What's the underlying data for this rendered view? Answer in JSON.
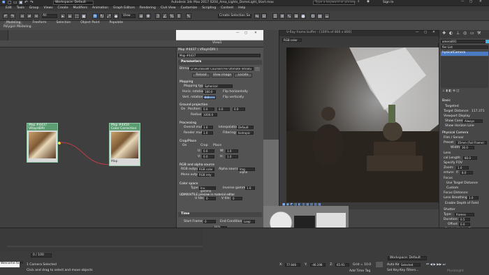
{
  "titlebar": {
    "workspace": "Workspace: Default",
    "title": "Autodesk 3ds Max 2017    0204_Area_Lights_DomeLight_Start.max",
    "search_placeholder": "Type a keyword or phrase",
    "sign_in": "Sign In"
  },
  "menubar": [
    "Edit",
    "Tools",
    "Group",
    "Views",
    "Create",
    "Modifiers",
    "Animation",
    "Graph Editors",
    "Rendering",
    "Civil View",
    "Customize",
    "Scripting",
    "Content",
    "Help"
  ],
  "toolbar": {
    "view_select": "View",
    "selection_set": "Create Selection Se"
  },
  "ribbon": {
    "tabs": [
      "Modeling",
      "Freeform",
      "Selection",
      "Object Paint",
      "Populate"
    ],
    "sub": "Polygon Modeling"
  },
  "sme": {
    "view_label": "View1",
    "node1": {
      "title": "Map #4437",
      "subtitle": "VRayHDRI"
    },
    "node2": {
      "title": "Map #4450",
      "subtitle": "Color Correction",
      "port": "Map"
    }
  },
  "panel": {
    "header": "Map #4437  ( VRayHDRI )",
    "name_field": "Map #4437",
    "rollout": "Parameters",
    "bitmap_label": "Bitmap",
    "bitmap_path": "D:\\Pluralsight Courses\\The Ultimate Introdu",
    "buttons": [
      "Reload",
      "View image",
      "Locate"
    ],
    "mapping_label": "Mapping",
    "mapping_type_label": "Mapping type:",
    "mapping_type": "Spherical",
    "horiz_rot_label": "Horiz. rotation:",
    "horiz_rot": "180.0",
    "flip_h": "Flip horizontally",
    "vert_rot_label": "Vert. rotation:",
    "vert_rot": "0.0",
    "flip_v": "Flip vertically",
    "ground_label": "Ground projection",
    "ground_on": "On",
    "position_label": "Position:",
    "position": [
      "0.0",
      "0.0",
      "0.0"
    ],
    "radius_label": "Radius:",
    "radius": "1000.0",
    "processing_label": "Processing",
    "overall_mult_label": "Overall mult:",
    "overall_mult": "1.0",
    "render_mult_label": "Render mult:",
    "render_mult": "1.0",
    "interp_label": "Interpolation:",
    "interp": "Default",
    "filtering_label": "Filtering:",
    "filtering": "Isotropic",
    "crop_label": "Crop/Place",
    "crop_on": "On",
    "crop": "Crop",
    "place": "Place",
    "u_label": "U:",
    "u": "0.0",
    "w_label": "W:",
    "w": "1.0",
    "v_label": "V:",
    "v": "0.0",
    "h_label": "H:",
    "h": "1.0",
    "rgb_label": "RGB and alpha source",
    "rgb_output_label": "RGB output:",
    "rgb_output": "RGB color",
    "alpha_source_label": "Alpha source:",
    "alpha_source": "Img. alpha",
    "mono_label": "Mono output:",
    "mono": "RGB inty",
    "colorspace_label": "Color space",
    "type_label": "Type:",
    "type": "Inv. gamma",
    "inv_gamma_label": "Inverse gamma:",
    "inv_gamma": "1.0",
    "udim_label": "UDIM/UVTILE preview in material editor",
    "u_tile_label": "U tile:",
    "u_tile": "0",
    "v_tile_label": "V tile:",
    "v_tile": "0",
    "time_label": "Time",
    "start_frame_label": "Start Frame:",
    "start_frame": "0",
    "end_cond_label": "End Condition:",
    "end_cond": "Loop",
    "zoom": "99%"
  },
  "vfb": {
    "title": "V-Ray frame buffer - [100% of 800 x 800]",
    "channel": "RGB color"
  },
  "rightpanel": {
    "header": "amera001",
    "modifier_list": "fier List",
    "object": "hysicalCamera",
    "basic_label": "Basic",
    "targeted": "Targeted",
    "target_dist_label": "Target Distance:",
    "target_dist": "117.371",
    "viewport_display": "Viewport Display",
    "show_cone_label": "Show Cone:",
    "show_cone": "Always",
    "show_horizon": "Show Horizon Line",
    "physical_label": "Physical Camera",
    "film_label": "Film / Sensor",
    "preset_label": "Preset:",
    "preset": "35mm (Full Frame)",
    "width_label": "Width:",
    "width": "36.0",
    "lens_label": "Lens",
    "focal_label": "cal Length:",
    "focal": "80.0",
    "fov_label": "Specify FOV",
    "zoom_label": "Zoom:",
    "zoom": "1.0",
    "aperture_label": "erture:",
    "aperture": "f/",
    "aperture_val": "8.0",
    "focus_label": "Focus",
    "use_target": "Use Target Distance",
    "custom": "Custom",
    "focus_dist": "Focus Distance:",
    "lens_breath_label": "Lens Breathing:",
    "lens_breath": "1.0",
    "enable_dof": "Enable Depth of Field",
    "shutter_label": "Shutter",
    "type_label": "Type:",
    "type": "frames",
    "duration_label": "Duration:",
    "duration": "0.5",
    "offset_label": "Offset:",
    "offset": "0.0",
    "motion_blur": "Enable Motion Blur",
    "exposure_label": "Exposure",
    "exposure_ctrl": "Exposure Co"
  },
  "bottom": {
    "camera_selected": "1 Camera Selected",
    "hint": "Click and drag to select and move objects",
    "welcome": "Welcome to M",
    "frame": "0 / 100",
    "x_label": "X:",
    "x": "77.846",
    "y_label": "Y:",
    "y": "-46.198",
    "z_label": "Z:",
    "z": "65.91",
    "grid": "Grid = 10.0",
    "add_time_tag": "Add Time Tag",
    "auto_key": "Auto Key",
    "selected": "Selected",
    "set_key": "Set Key",
    "key_filters": "Key Filters...",
    "workspace": "Workspace: Default",
    "watermark": "Pluralsight"
  }
}
